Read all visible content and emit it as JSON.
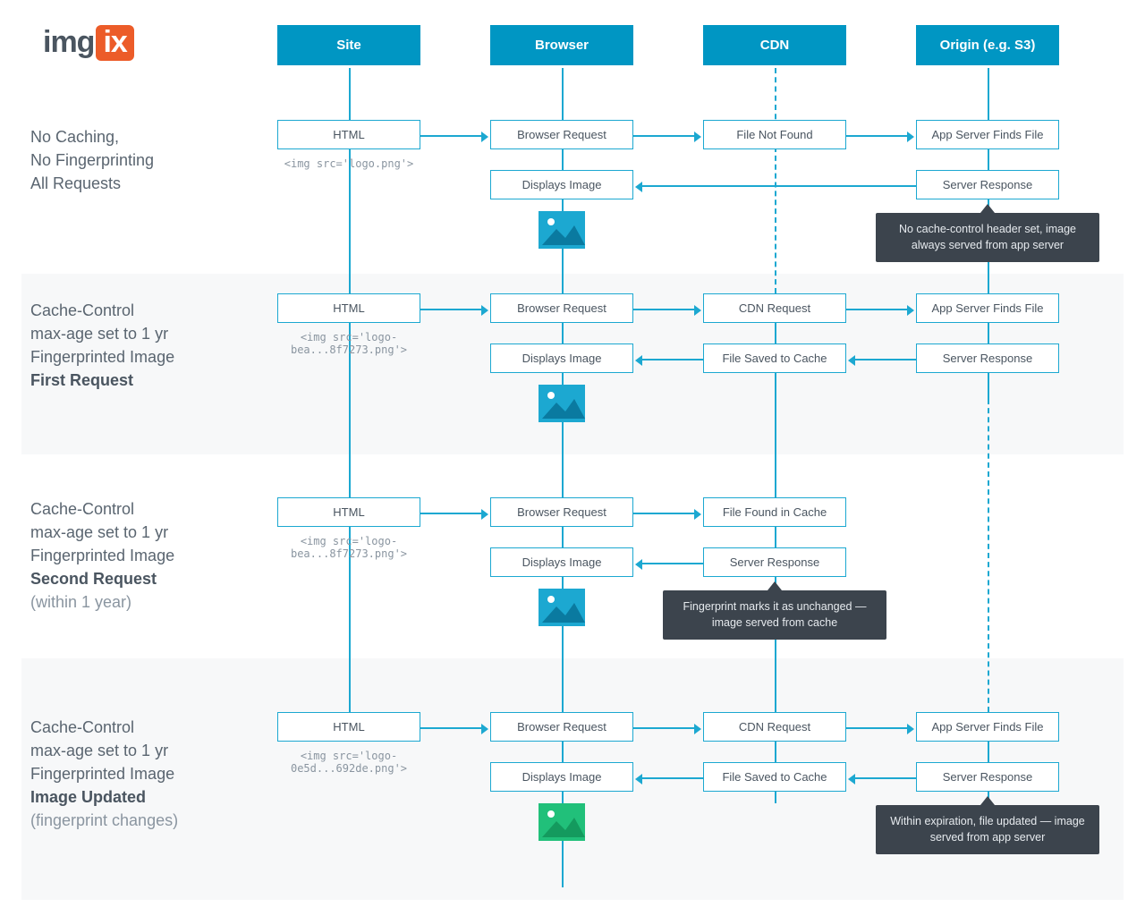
{
  "logo": {
    "text": "img",
    "badge": "ix"
  },
  "columns": {
    "site": "Site",
    "browser": "Browser",
    "cdn": "CDN",
    "origin": "Origin (e.g. S3)"
  },
  "rows": [
    {
      "label_lines": [
        "No Caching,",
        "No Fingerprinting",
        "All Requests"
      ],
      "bold_lines": [],
      "light_lines": [],
      "code": "<img src='logo.png'>",
      "site_box": "HTML",
      "browser_box1": "Browser Request",
      "browser_box2": "Displays Image",
      "cdn_box1": "File Not Found",
      "origin_box1": "App Server Finds File",
      "origin_box2": "Server Response",
      "tooltip": "No cache-control header set, image always served from app server",
      "img_color": "blue"
    },
    {
      "label_lines": [
        "Cache-Control",
        "max-age set to 1 yr",
        "Fingerprinted Image"
      ],
      "bold_lines": [
        "First Request"
      ],
      "light_lines": [],
      "code": "<img src='logo-bea...8f7273.png'>",
      "site_box": "HTML",
      "browser_box1": "Browser Request",
      "browser_box2": "Displays Image",
      "cdn_box1": "CDN Request",
      "cdn_box2": "File Saved to Cache",
      "origin_box1": "App Server Finds File",
      "origin_box2": "Server Response",
      "img_color": "blue"
    },
    {
      "label_lines": [
        "Cache-Control",
        "max-age set to 1 yr",
        "Fingerprinted Image"
      ],
      "bold_lines": [
        "Second Request"
      ],
      "light_lines": [
        "(within 1 year)"
      ],
      "code": "<img src='logo-bea...8f7273.png'>",
      "site_box": "HTML",
      "browser_box1": "Browser Request",
      "browser_box2": "Displays Image",
      "cdn_box1": "File Found in Cache",
      "cdn_box2": "Server Response",
      "tooltip": "Fingerprint marks it as unchanged — image served from cache",
      "img_color": "blue"
    },
    {
      "label_lines": [
        "Cache-Control",
        "max-age set to 1 yr",
        "Fingerprinted Image"
      ],
      "bold_lines": [
        "Image Updated"
      ],
      "light_lines": [
        "(fingerprint changes)"
      ],
      "code": "<img src='logo-0e5d...692de.png'>",
      "site_box": "HTML",
      "browser_box1": "Browser Request",
      "browser_box2": "Displays Image",
      "cdn_box1": "CDN Request",
      "cdn_box2": "File Saved to Cache",
      "origin_box1": "App Server Finds File",
      "origin_box2": "Server Response",
      "tooltip": "Within expiration, file updated — image served from app server",
      "img_color": "green"
    }
  ]
}
